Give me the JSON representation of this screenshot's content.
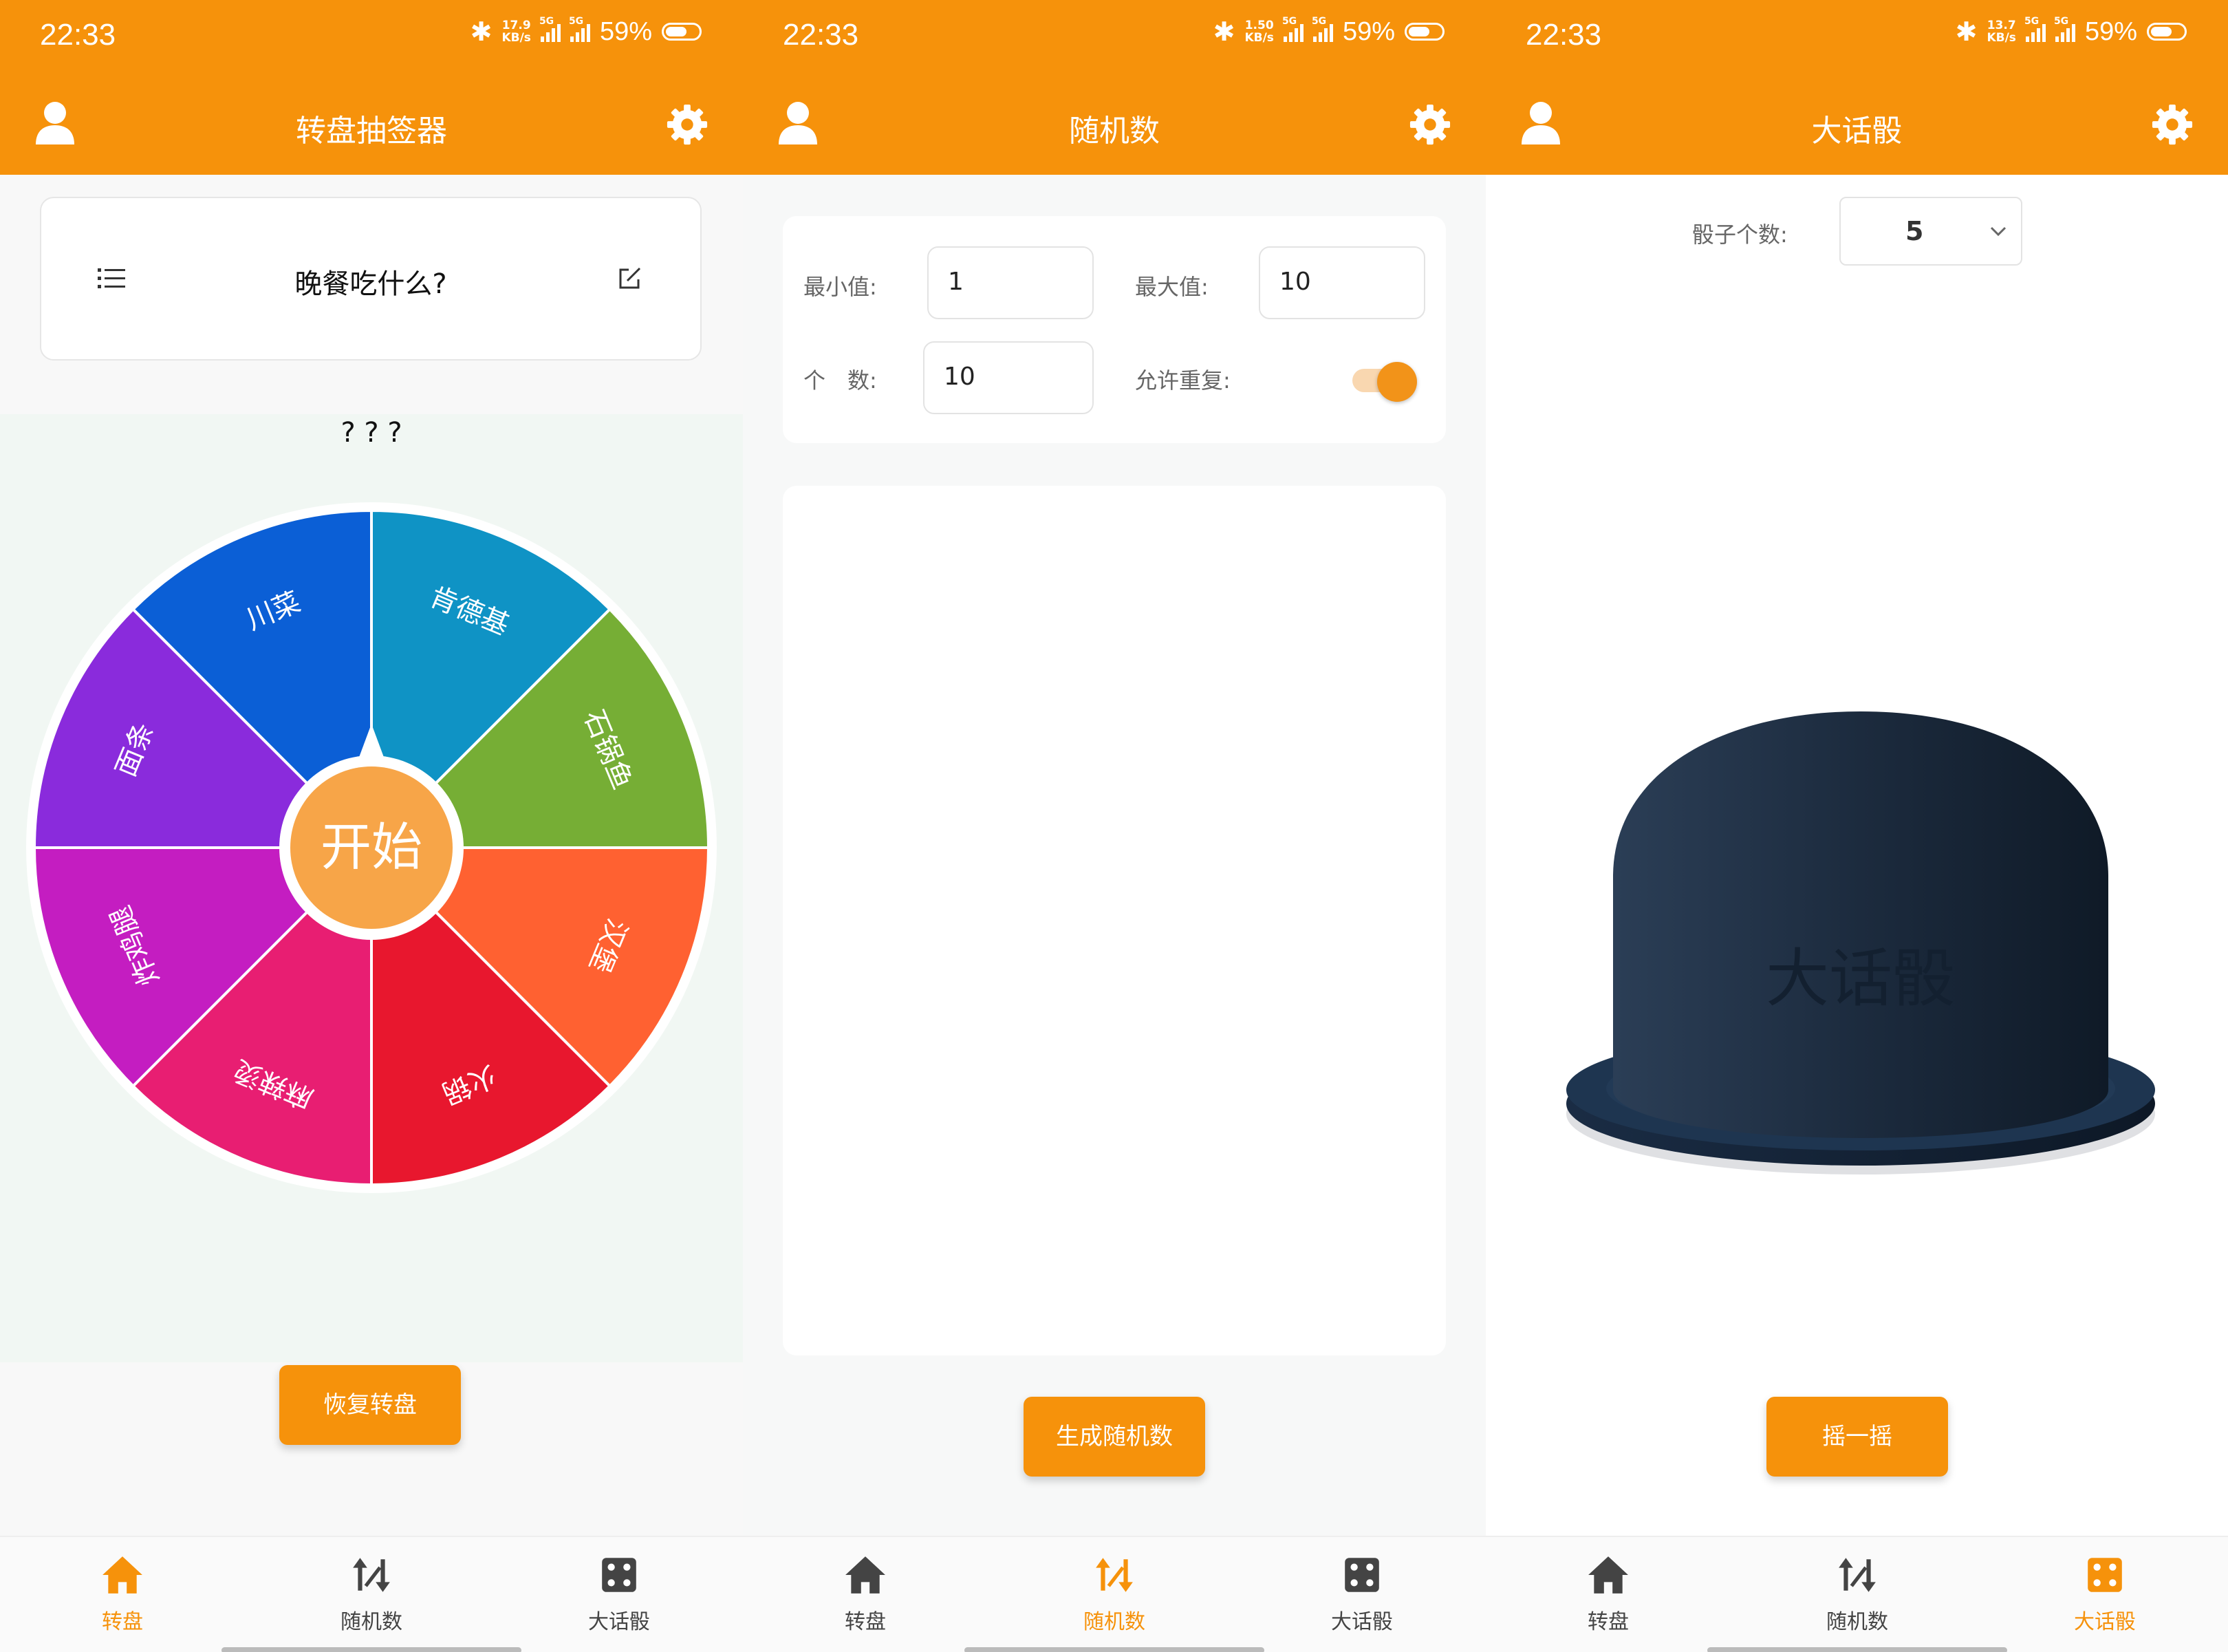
{
  "status_bars": [
    {
      "time": "22:33",
      "speed_top": "17.9",
      "speed_bottom": "KB/s",
      "battery": "59%"
    },
    {
      "time": "22:33",
      "speed_top": "1.50",
      "speed_bottom": "KB/s",
      "battery": "59%"
    },
    {
      "time": "22:33",
      "speed_top": "13.7",
      "speed_bottom": "KB/s",
      "battery": "59%"
    }
  ],
  "network_label": "5G",
  "colors": {
    "accent": "#f6920b",
    "wheel_center": "#f7a548",
    "cup": "#1c2b3e"
  },
  "screen1": {
    "title": "转盘抽签器",
    "question": "晚餐吃什么?",
    "result": "? ? ?",
    "start_label": "开始",
    "wheel_slices": [
      {
        "label": "肯德基",
        "color": "#0f93c5"
      },
      {
        "label": "石锅鱼",
        "color": "#76ae35"
      },
      {
        "label": "汉堡",
        "color": "#ff6131"
      },
      {
        "label": "火锅",
        "color": "#e8172e"
      },
      {
        "label": "麻辣烫",
        "color": "#e81e72"
      },
      {
        "label": "炸鸡腿",
        "color": "#c41dc1"
      },
      {
        "label": "面条",
        "color": "#8a2bdc"
      },
      {
        "label": "川菜",
        "color": "#0b5fd6"
      }
    ],
    "reset_button": "恢复转盘"
  },
  "screen2": {
    "title": "随机数",
    "min_label": "最小值:",
    "min_value": "1",
    "max_label": "最大值:",
    "max_value": "10",
    "count_label": "个　数:",
    "count_value": "10",
    "repeat_label": "允许重复:",
    "repeat_enabled": true,
    "generate_button": "生成随机数"
  },
  "screen3": {
    "title": "大话骰",
    "dice_count_label": "骰子个数:",
    "dice_count_value": "5",
    "cup_label": "大话骰",
    "shake_button": "摇一摇"
  },
  "tabs": [
    {
      "label": "转盘",
      "icon": "home-icon"
    },
    {
      "label": "随机数",
      "icon": "shuffle-icon"
    },
    {
      "label": "大话骰",
      "icon": "dice-icon"
    }
  ]
}
